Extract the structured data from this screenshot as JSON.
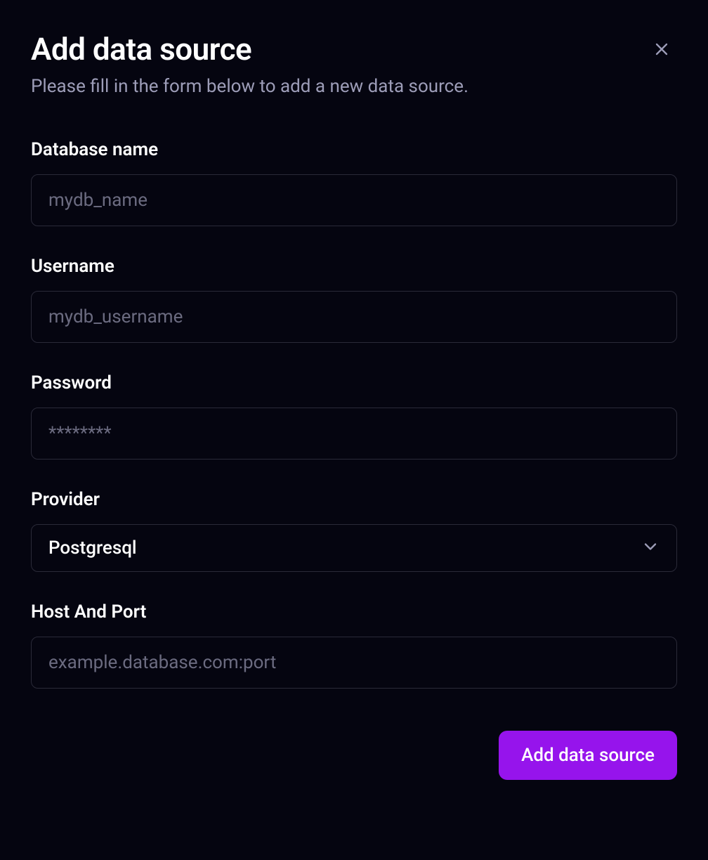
{
  "header": {
    "title": "Add data source",
    "subtitle": "Please fill in the form below to add a new data source."
  },
  "form": {
    "database_name": {
      "label": "Database name",
      "placeholder": "mydb_name",
      "value": ""
    },
    "username": {
      "label": "Username",
      "placeholder": "mydb_username",
      "value": ""
    },
    "password": {
      "label": "Password",
      "placeholder": "********",
      "value": ""
    },
    "provider": {
      "label": "Provider",
      "selected": "Postgresql"
    },
    "host_port": {
      "label": "Host And Port",
      "placeholder": "example.database.com:port",
      "value": ""
    }
  },
  "actions": {
    "submit_label": "Add data source"
  }
}
